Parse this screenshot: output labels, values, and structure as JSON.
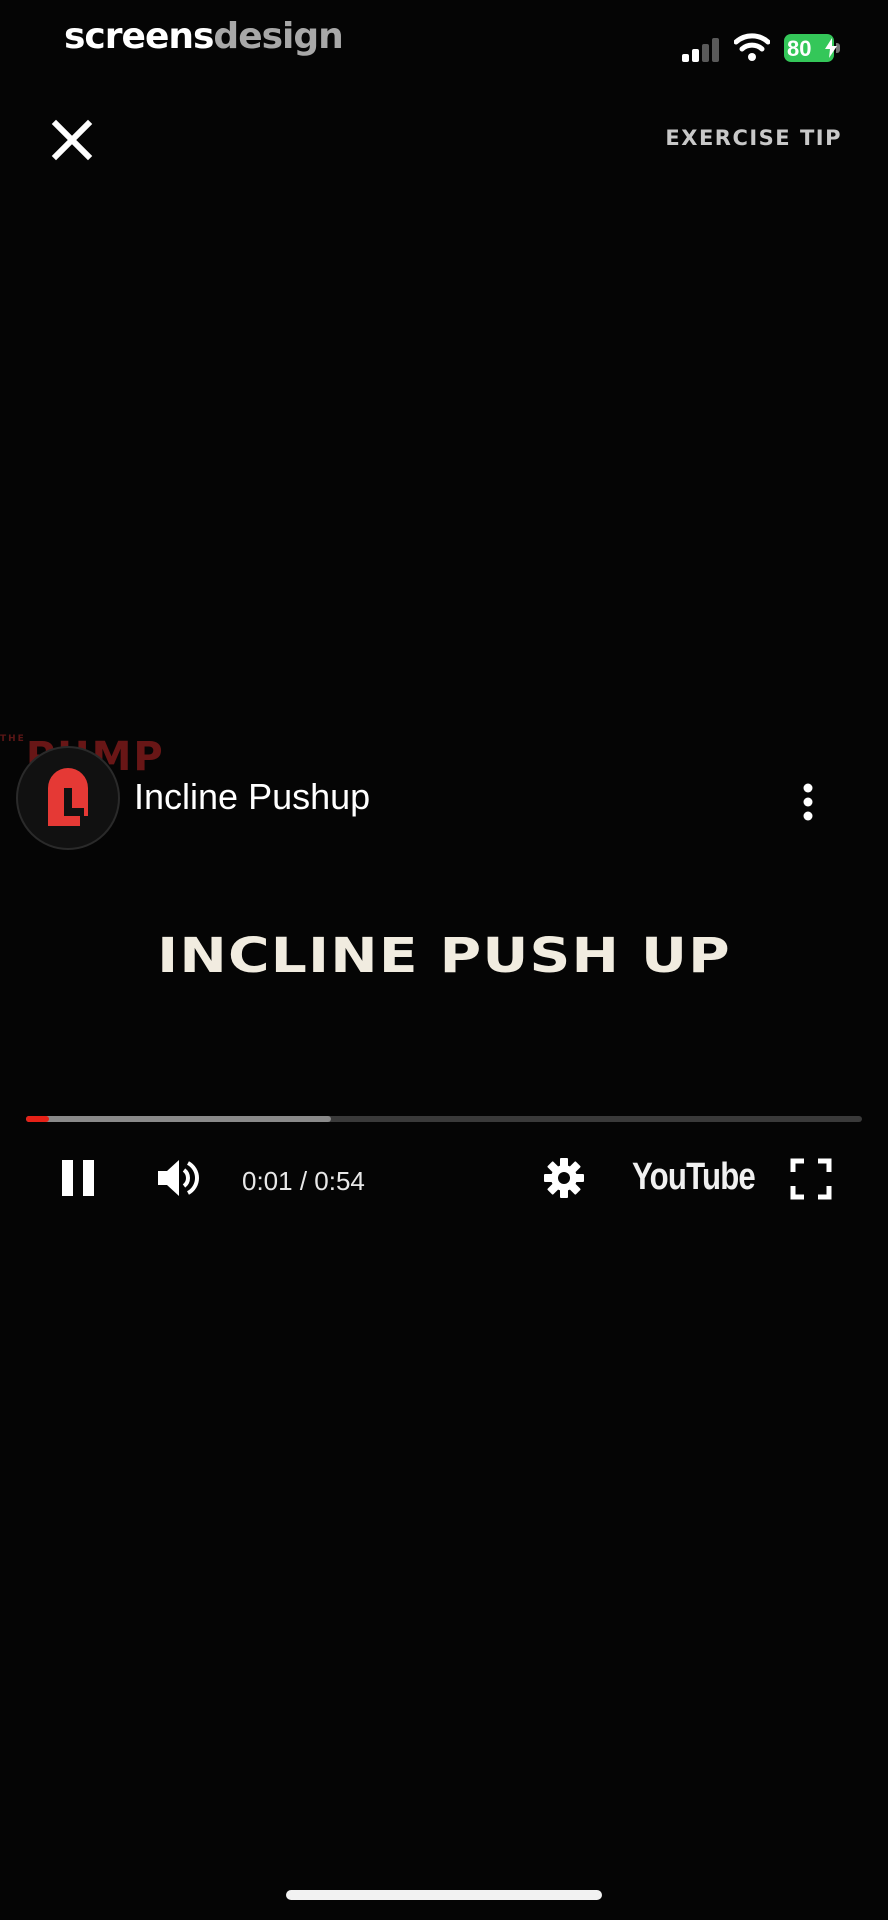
{
  "status_bar": {
    "brand_part1": "screens",
    "brand_part2": "design",
    "battery_level": "80"
  },
  "top_nav": {
    "close_icon": "close-icon",
    "exercise_tip_label": "EXERCISE TIP"
  },
  "video": {
    "channel_logo_text": "PUMP",
    "channel_logo_small": "THE",
    "title": "Incline Pushup",
    "overlay_title": "INCLINE PUSH UP",
    "progress": {
      "played_fraction": 0.027,
      "buffered_fraction": 0.365
    },
    "controls": {
      "time": "0:01 / 0:54",
      "brand": "YouTube"
    }
  },
  "colors": {
    "background": "#050505",
    "played": "#e62117",
    "battery": "#34c759",
    "logo_red": "#e53935"
  }
}
